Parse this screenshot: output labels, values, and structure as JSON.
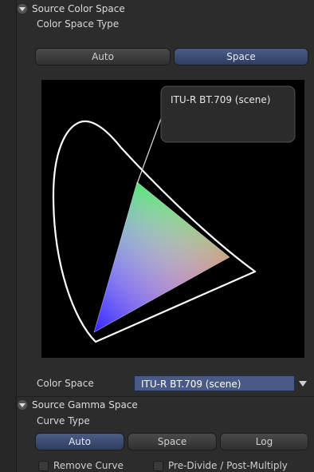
{
  "source_color_space": {
    "header": "Source Color Space",
    "type_label": "Color Space Type",
    "buttons": {
      "auto": "Auto",
      "space": "Space"
    },
    "active": "space"
  },
  "chart": {
    "annotation": "ITU-R BT.709 (scene)"
  },
  "color_space": {
    "label": "Color Space",
    "selected": "ITU-R BT.709 (scene)"
  },
  "source_gamma_space": {
    "header": "Source Gamma Space",
    "curve_label": "Curve Type",
    "buttons": {
      "auto": "Auto",
      "space": "Space",
      "log": "Log"
    },
    "active": "auto"
  },
  "checks": {
    "remove_curve": "Remove Curve",
    "pre_divide": "Pre-Divide / Post-Multiply"
  },
  "colors": {
    "active_button": "#3e4f7a",
    "panel_bg": "#2c2c2c",
    "chart_bg": "#000000"
  }
}
